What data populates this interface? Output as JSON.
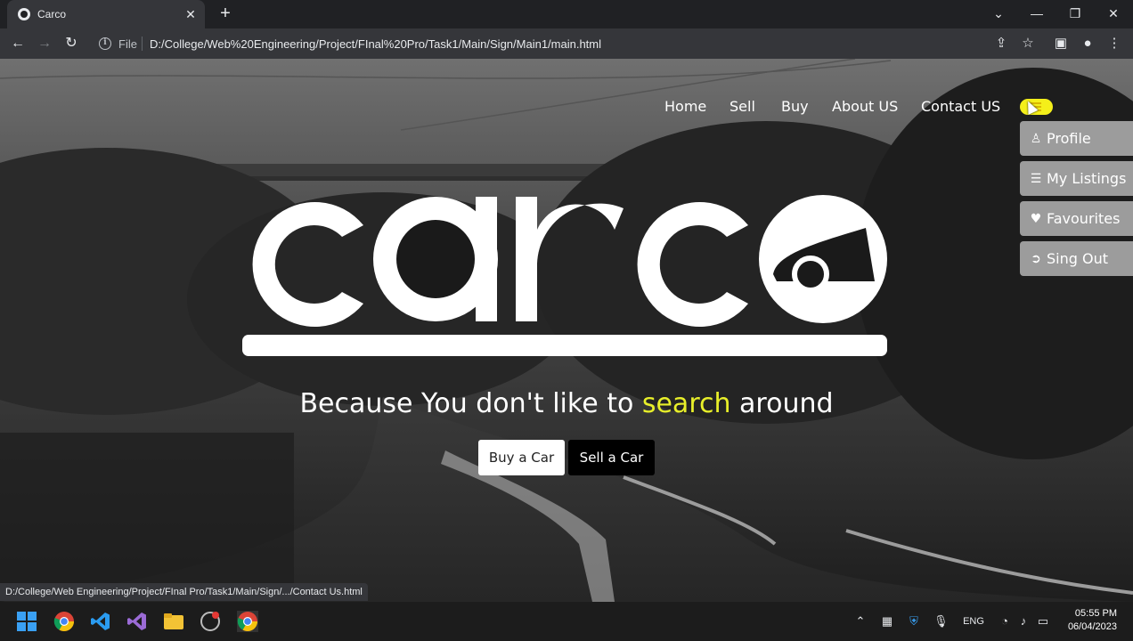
{
  "browser": {
    "tab_title": "Carco",
    "file_label": "File",
    "url": "D:/College/Web%20Engineering/Project/FInal%20Pro/Task1/Main/Sign/Main1/main.html",
    "status_url": "D:/College/Web Engineering/Project/FInal Pro/Task1/Main/Sign/.../Contact Us.html"
  },
  "nav": {
    "items": [
      {
        "label": "Home"
      },
      {
        "label": "Sell"
      },
      {
        "label": "Buy"
      },
      {
        "label": "About US"
      },
      {
        "label": "Contact US"
      }
    ]
  },
  "dropdown": {
    "items": [
      {
        "label": "Profile",
        "icon": "user-icon"
      },
      {
        "label": "My Listings",
        "icon": "list-icon"
      },
      {
        "label": "Favourites",
        "icon": "heart-icon"
      },
      {
        "label": "Sing Out",
        "icon": "sign-out-icon"
      }
    ]
  },
  "hero": {
    "logo_text": "carco",
    "tagline_before": "Because You don't like to ",
    "tagline_highlight": "search",
    "tagline_after": " around",
    "buy_button": "Buy a Car",
    "sell_button": "Sell a Car"
  },
  "colors": {
    "accent": "#e8ef2a",
    "toggle": "#f4ef1a"
  },
  "taskbar": {
    "language": "ENG",
    "time": "05:55 PM",
    "date": "06/04/2023"
  }
}
